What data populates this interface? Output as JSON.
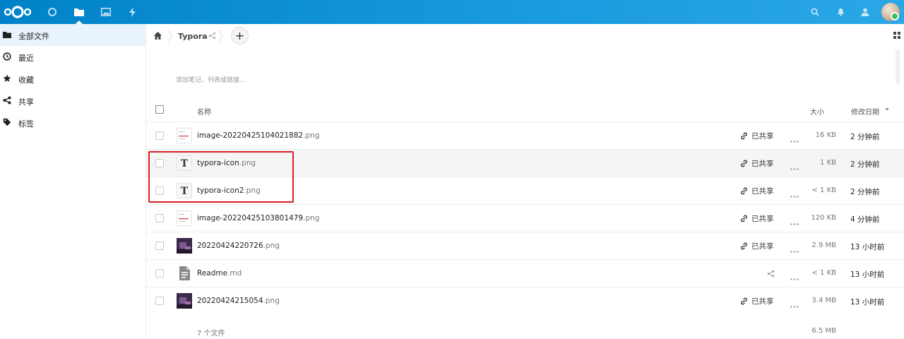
{
  "header": {
    "apps": [
      "dashboard-icon",
      "files-icon",
      "photos-icon",
      "activity-icon"
    ],
    "active_app": "files-icon",
    "right_icons": [
      "search-icon",
      "notifications-icon",
      "contacts-icon"
    ]
  },
  "sidebar": {
    "items": [
      {
        "label": "全部文件",
        "icon": "folder-icon",
        "active": true
      },
      {
        "label": "最近",
        "icon": "clock-icon",
        "active": false
      },
      {
        "label": "收藏",
        "icon": "star-icon",
        "active": false
      },
      {
        "label": "共享",
        "icon": "share-icon",
        "active": false
      },
      {
        "label": "标签",
        "icon": "tag-icon",
        "active": false
      }
    ]
  },
  "breadcrumb": {
    "folder": "Typora"
  },
  "notes_placeholder": "添加笔记、列表或链接...",
  "table": {
    "headers": {
      "name": "名称",
      "size": "大小",
      "modified": "修改日期"
    },
    "rows": [
      {
        "base": "image-20220425104021882",
        "ext": ".png",
        "shared": "已共享",
        "size": "16 KB",
        "mtime": "2 分钟前",
        "thumb": "image"
      },
      {
        "base": "typora-icon",
        "ext": ".png",
        "shared": "已共享",
        "size": "1 KB",
        "mtime": "2 分钟前",
        "thumb": "typora"
      },
      {
        "base": "typora-icon2",
        "ext": ".png",
        "shared": "已共享",
        "size": "< 1 KB",
        "mtime": "2 分钟前",
        "thumb": "typora"
      },
      {
        "base": "image-20220425103801479",
        "ext": ".png",
        "shared": "已共享",
        "size": "120 KB",
        "mtime": "4 分钟前",
        "thumb": "image"
      },
      {
        "base": "20220424220726",
        "ext": ".png",
        "shared": "已共享",
        "size": "2.9 MB",
        "mtime": "13 小时前",
        "thumb": "photo"
      },
      {
        "base": "Readme",
        "ext": ".md",
        "shared": "",
        "size": "< 1 KB",
        "mtime": "13 小时前",
        "thumb": "doc"
      },
      {
        "base": "20220424215054",
        "ext": ".png",
        "shared": "已共享",
        "size": "3.4 MB",
        "mtime": "13 小时前",
        "thumb": "photo"
      }
    ]
  },
  "footer": {
    "count": "7 个文件",
    "total": "6.5 MB"
  },
  "colors": {
    "header": "#0082c9",
    "active_nav": "#e8f3fb",
    "highlight": "#d72027"
  }
}
